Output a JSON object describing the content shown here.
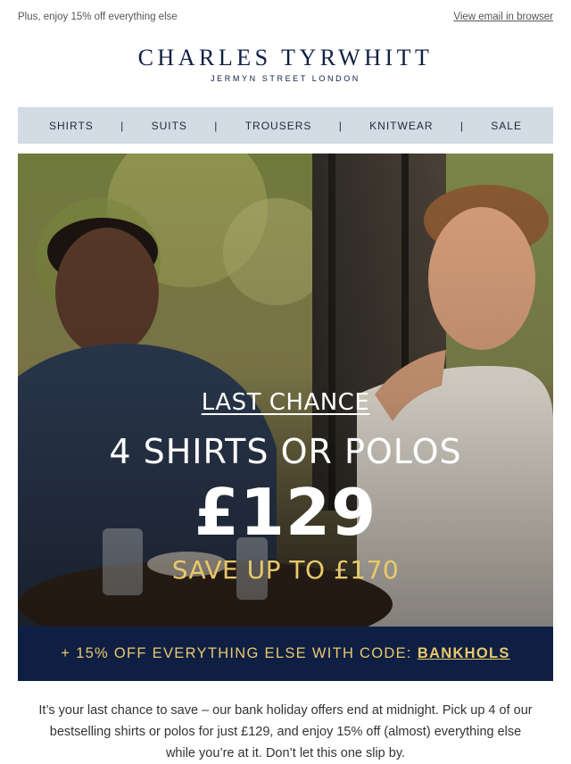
{
  "preheader": {
    "left_text": "Plus, enjoy 15% off everything else",
    "view_in_browser": "View email in browser"
  },
  "brand": {
    "name": "CHARLES TYRWHITT",
    "tagline": "JERMYN STREET LONDON",
    "color": "#0f1f44"
  },
  "nav": {
    "items": [
      {
        "label": "SHIRTS"
      },
      {
        "label": "SUITS"
      },
      {
        "label": "TROUSERS"
      },
      {
        "label": "KNITWEAR"
      },
      {
        "label": "SALE"
      }
    ],
    "separator": "|",
    "background": "#d3dbe4"
  },
  "hero": {
    "kicker": "LAST CHANCE",
    "headline": "4 SHIRTS OR POLOS",
    "price": "£129",
    "save": "SAVE UP TO £170",
    "accent": "#e9c96a"
  },
  "codebar": {
    "prefix": "+ 15% OFF EVERYTHING ELSE WITH CODE:",
    "code": "BANKHOLS",
    "background": "#0f1f44"
  },
  "body": {
    "paragraph": "It’s your last chance to save – our bank holiday offers end at midnight. Pick up 4 of our bestselling shirts or polos for just £129, and enjoy 15% off (almost) everything else while you’re at it. Don’t let this one slip by."
  }
}
